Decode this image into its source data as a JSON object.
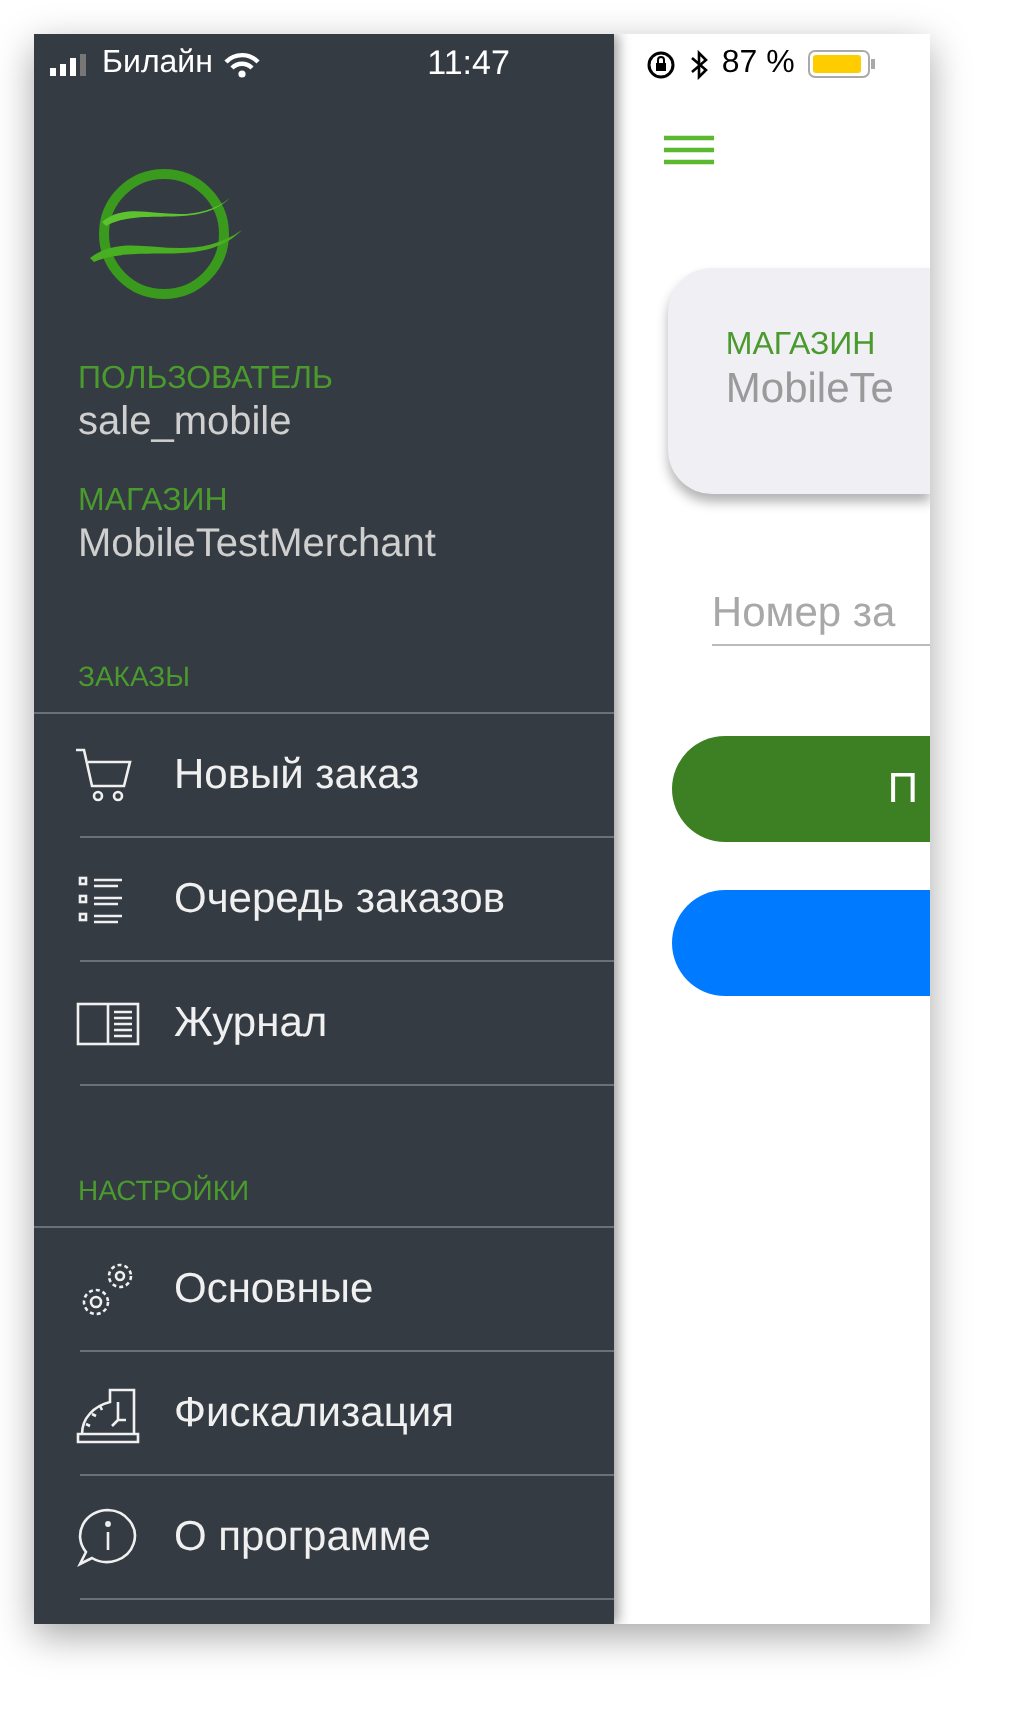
{
  "status_bar": {
    "carrier": "Билайн",
    "time": "11:47",
    "battery": "87 %"
  },
  "profile": [
    {
      "label": "ПОЛЬЗОВАТЕЛЬ",
      "value": "sale_mobile"
    },
    {
      "label": "МАГАЗИН",
      "value": "MobileTestMerchant"
    }
  ],
  "menu_sections": [
    {
      "title": "ЗАКАЗЫ",
      "items": [
        {
          "label": "Новый заказ",
          "kind": "cart"
        },
        {
          "label": "Очередь заказов",
          "kind": "list"
        },
        {
          "label": "Журнал",
          "kind": "journal"
        }
      ]
    },
    {
      "title": "НАСТРОЙКИ",
      "items": [
        {
          "label": "Основные",
          "kind": "gears"
        },
        {
          "label": "Фискализация",
          "kind": "register"
        },
        {
          "label": "О программе",
          "kind": "info"
        }
      ]
    }
  ],
  "store_card": {
    "label": "МАГАЗИН",
    "value": "MobileTe"
  },
  "order_field": {
    "placeholder": "Номер за"
  },
  "buttons": [
    {
      "label": "П",
      "kind": "primary"
    },
    {
      "kind": "secondary"
    }
  ]
}
